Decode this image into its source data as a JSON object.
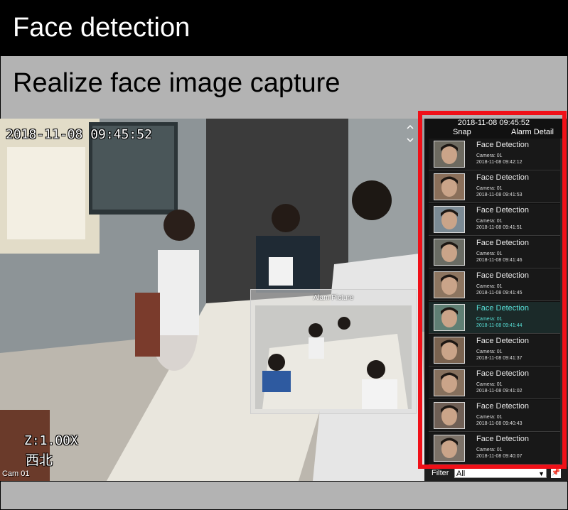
{
  "header": {
    "title": "Face detection"
  },
  "subheader": {
    "title": "Realize face image capture"
  },
  "video": {
    "timestamp": "2018-11-08 09:45:52",
    "zoom": "Z:1.00X",
    "direction": "西北",
    "camera_label": "Cam 01"
  },
  "alarm_popup": {
    "title": "Alam Picture"
  },
  "panel": {
    "time": "2018-11-08 09:45:52",
    "snap_header": "Snap",
    "detail_header": "Alarm Detail",
    "items": [
      {
        "title": "Face Detection",
        "camera": "Camera: 01",
        "time": "2018-11-08 09:42:12"
      },
      {
        "title": "Face Detection",
        "camera": "Camera: 01",
        "time": "2018-11-08 09:41:53"
      },
      {
        "title": "Face Detection",
        "camera": "Camera: 01",
        "time": "2018-11-08 09:41:51"
      },
      {
        "title": "Face Detection",
        "camera": "Camera: 01",
        "time": "2018-11-08 09:41:46"
      },
      {
        "title": "Face Detection",
        "camera": "Camera: 01",
        "time": "2018-11-08 09:41:45"
      },
      {
        "title": "Face Detection",
        "camera": "Camera: 01",
        "time": "2018-11-08 09:41:44",
        "selected": true
      },
      {
        "title": "Face Detection",
        "camera": "Camera: 01",
        "time": "2018-11-08 09:41:37"
      },
      {
        "title": "Face Detection",
        "camera": "Camera: 01",
        "time": "2018-11-08 09:41:02"
      },
      {
        "title": "Face Detection",
        "camera": "Camera: 01",
        "time": "2018-11-08 09:40:43"
      },
      {
        "title": "Face Detection",
        "camera": "Camera: 01",
        "time": "2018-11-08 09:40:07"
      }
    ]
  },
  "filter": {
    "label": "Filter",
    "value": "All"
  },
  "colors": {
    "highlight_frame": "#f01018",
    "selected_text": "#58e0d8",
    "header_bg": "#000000",
    "subheader_bg": "#b3b3b3"
  }
}
